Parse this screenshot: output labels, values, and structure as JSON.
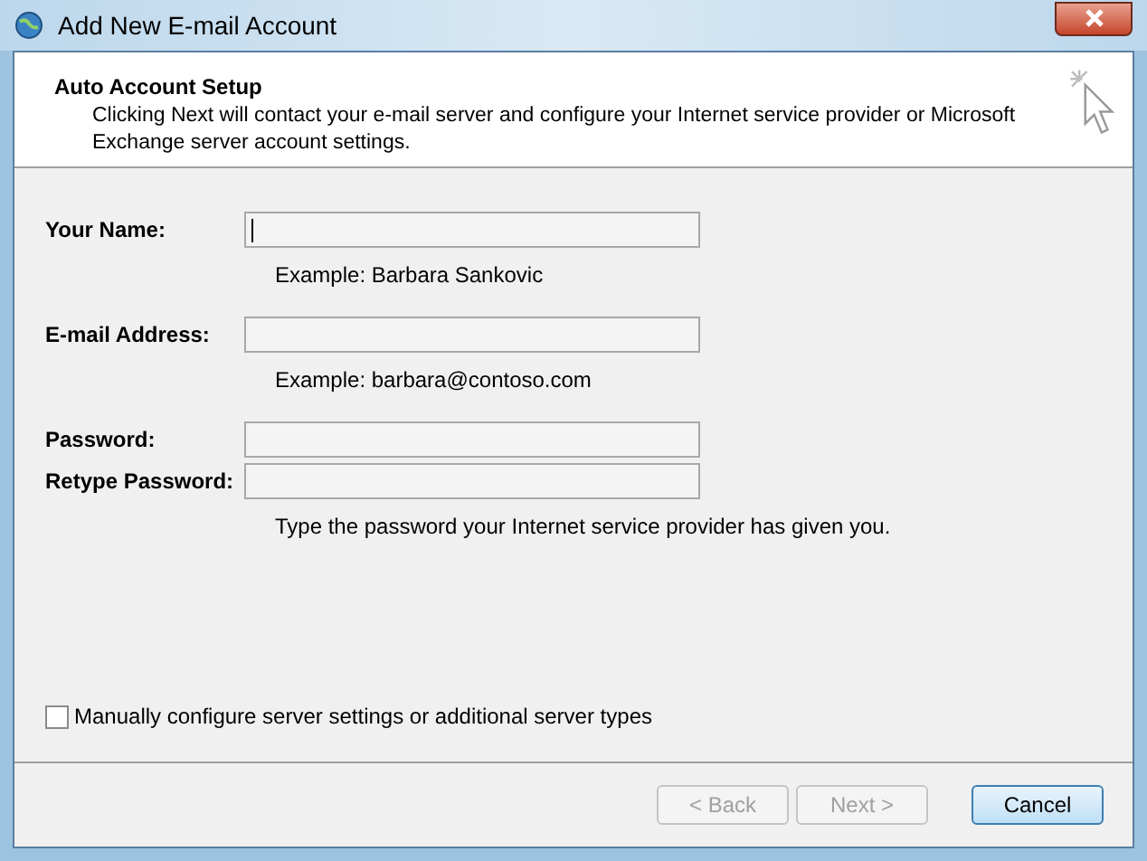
{
  "window": {
    "title": "Add New E-mail Account"
  },
  "header": {
    "title": "Auto Account Setup",
    "description": "Clicking Next will contact your e-mail server and configure your Internet service provider or Microsoft Exchange server account settings."
  },
  "fields": [
    {
      "label": "Your Name:",
      "hint": "Example: Barbara Sankovic",
      "focused": true
    },
    {
      "label": "E-mail Address:",
      "hint": "Example: barbara@contoso.com",
      "focused": false
    },
    {
      "label": "Password:",
      "focused": false
    },
    {
      "label": "Retype Password:",
      "hint": "Type the password your Internet service provider has given you.",
      "focused": false
    }
  ],
  "manual_config": {
    "label": "Manually configure server settings or additional server types",
    "checked": false
  },
  "buttons": [
    {
      "label": "< Back",
      "disabled": true,
      "default": false
    },
    {
      "label": "Next >",
      "disabled": true,
      "default": false
    },
    {
      "label": "Cancel",
      "disabled": false,
      "default": true
    }
  ]
}
